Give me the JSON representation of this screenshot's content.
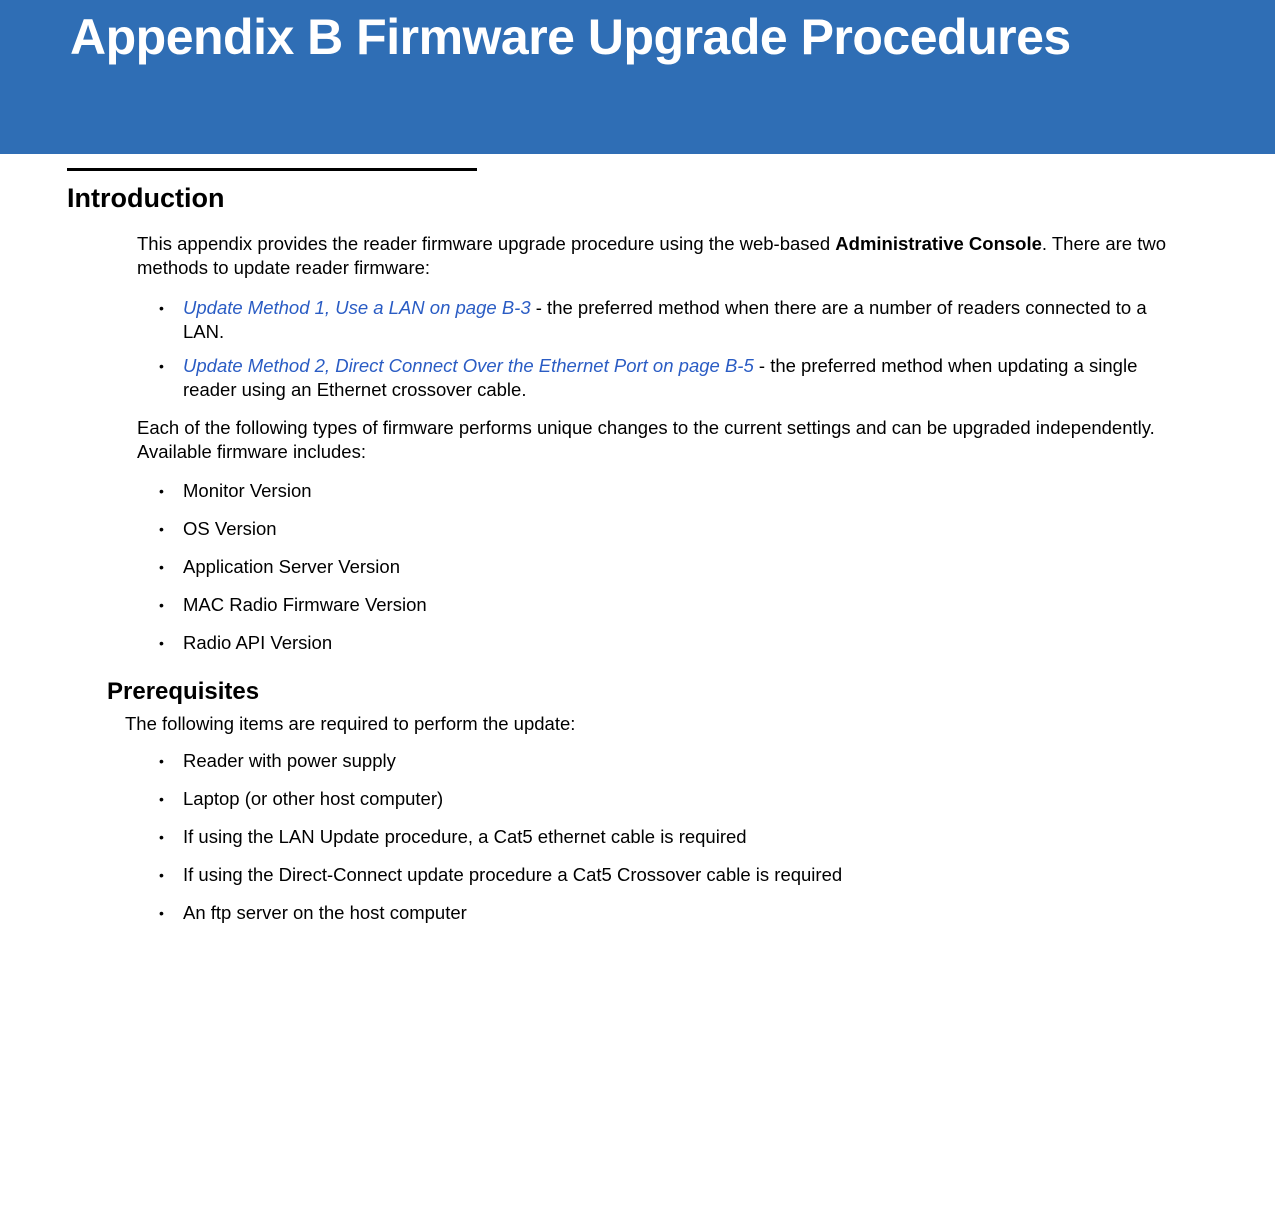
{
  "header": {
    "title": "Appendix B  Firmware Upgrade Procedures"
  },
  "introduction": {
    "heading": "Introduction",
    "intro_text_1": "This appendix provides the reader firmware upgrade procedure using the web-based ",
    "intro_text_bold": "Administrative Console",
    "intro_text_2": ". There are two methods to update reader firmware:",
    "methods": [
      {
        "link": "Update Method 1, Use a LAN on page B-3",
        "suffix": " - the preferred method when there are a number of readers connected to a LAN."
      },
      {
        "link": "Update Method 2, Direct Connect Over the Ethernet Port on page B-5",
        "suffix": " - the preferred method when updating a single reader using an Ethernet crossover cable."
      }
    ],
    "firmware_intro": "Each of the following types of firmware performs unique changes to the current settings and can be upgraded independently. Available firmware includes:",
    "firmware_list": [
      "Monitor Version",
      "OS Version",
      "Application Server Version",
      "MAC Radio Firmware Version",
      "Radio API Version"
    ]
  },
  "prerequisites": {
    "heading": "Prerequisites",
    "intro": "The following items are required to perform the update:",
    "items": [
      "Reader with power supply",
      "Laptop (or other host computer)",
      "If using the LAN Update procedure, a Cat5 ethernet cable is required",
      "If using the Direct-Connect update procedure a Cat5 Crossover cable is required",
      "An ftp server on the host computer"
    ]
  }
}
